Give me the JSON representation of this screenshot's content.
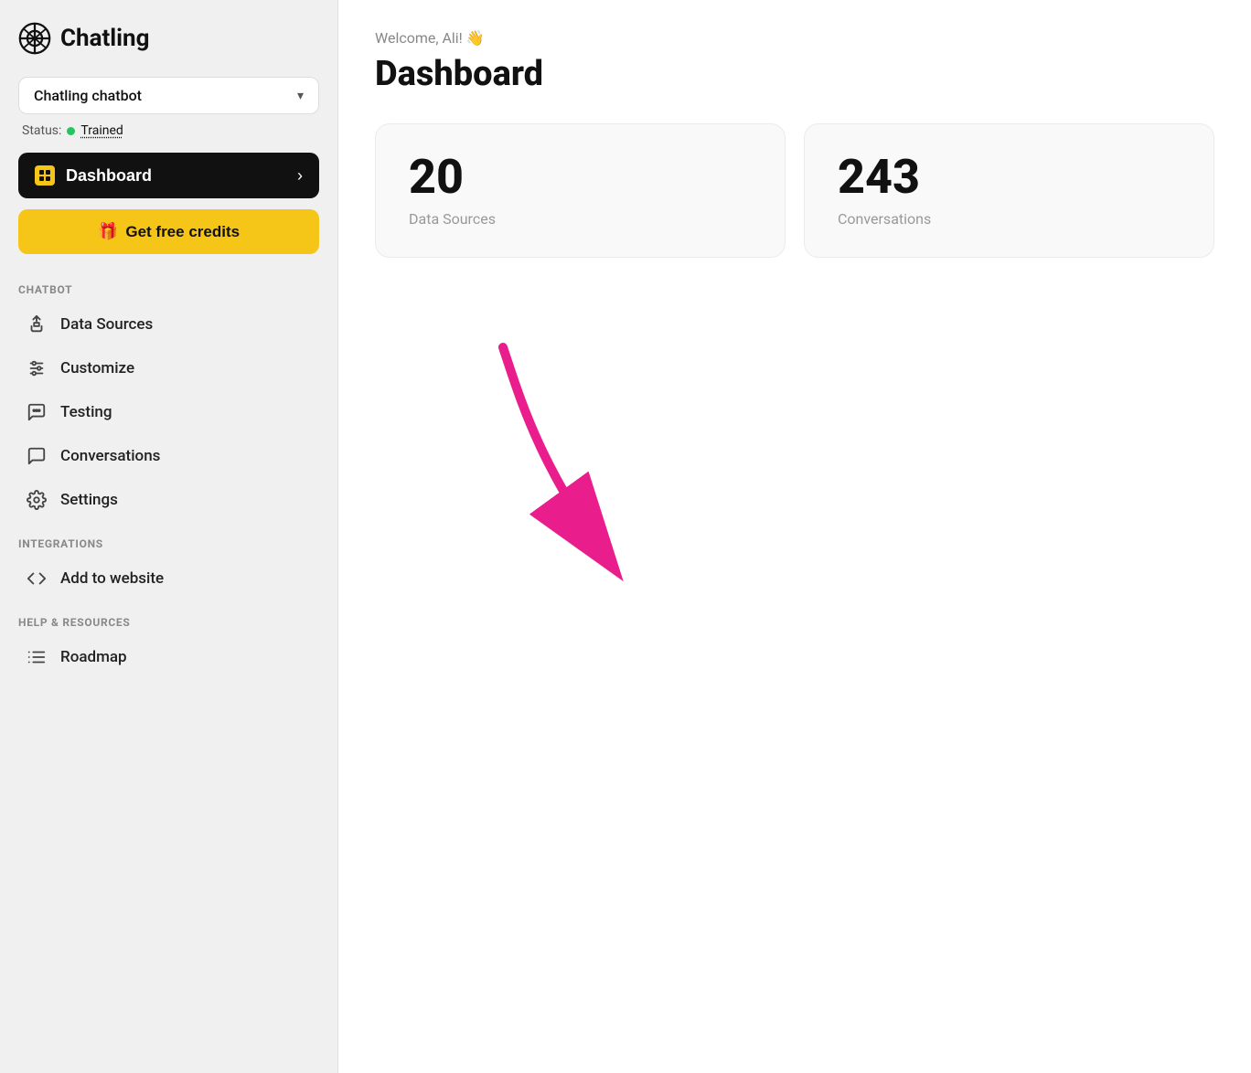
{
  "app": {
    "logo_text": "Chatling",
    "chatbot_selector": {
      "label": "Chatling chatbot",
      "chevron": "▾"
    },
    "status": {
      "prefix": "Status:",
      "value": "Trained"
    },
    "dashboard_button": {
      "label": "Dashboard",
      "arrow": "›"
    },
    "get_credits_button": {
      "emoji": "🎁",
      "label": "Get free credits"
    }
  },
  "sidebar": {
    "sections": [
      {
        "id": "chatbot",
        "label": "CHATBOT",
        "items": [
          {
            "id": "data-sources",
            "label": "Data Sources",
            "icon": "plug"
          },
          {
            "id": "customize",
            "label": "Customize",
            "icon": "customize"
          },
          {
            "id": "testing",
            "label": "Testing",
            "icon": "chat"
          },
          {
            "id": "conversations",
            "label": "Conversations",
            "icon": "bubble"
          },
          {
            "id": "settings",
            "label": "Settings",
            "icon": "gear"
          }
        ]
      },
      {
        "id": "integrations",
        "label": "INTEGRATIONS",
        "items": [
          {
            "id": "add-to-website",
            "label": "Add to website",
            "icon": "code"
          }
        ]
      },
      {
        "id": "help",
        "label": "HELP & RESOURCES",
        "items": [
          {
            "id": "roadmap",
            "label": "Roadmap",
            "icon": "list"
          }
        ]
      }
    ]
  },
  "main": {
    "welcome": "Welcome, Ali! 👋",
    "title": "Dashboard",
    "stats": [
      {
        "id": "data-sources",
        "number": "20",
        "label": "Data Sources"
      },
      {
        "id": "conversations",
        "number": "243",
        "label": "Conversations"
      }
    ]
  }
}
